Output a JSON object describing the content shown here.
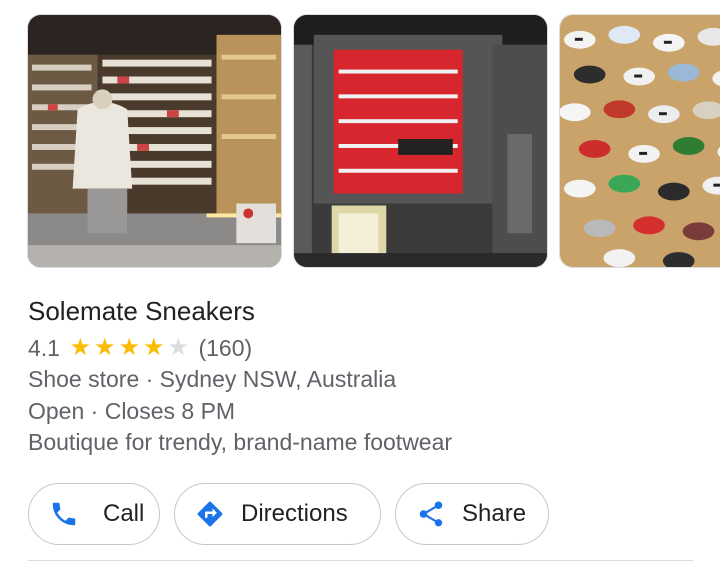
{
  "photos": [
    {
      "alt": "store-interior"
    },
    {
      "alt": "shoe-box-display"
    },
    {
      "alt": "sneaker-wall"
    }
  ],
  "business": {
    "name": "Solemate Sneakers",
    "rating": "4.1",
    "rating_value": 4.1,
    "stars_filled": 4,
    "stars_total": 5,
    "review_count": "(160)",
    "category_line": "Shoe store · Sydney NSW, Australia",
    "hours_line": "Open · Closes 8 PM",
    "description": "Boutique for trendy, brand-name footwear"
  },
  "actions": {
    "call_label": "Call",
    "directions_label": "Directions",
    "share_label": "Share"
  },
  "colors": {
    "accent": "#1a73e8",
    "star": "#fbbc04",
    "text_primary": "#202124",
    "text_secondary": "#5f6368",
    "border": "#c5c6c9"
  },
  "icons": {
    "call": "phone-icon",
    "directions": "directions-icon",
    "share": "share-icon"
  }
}
